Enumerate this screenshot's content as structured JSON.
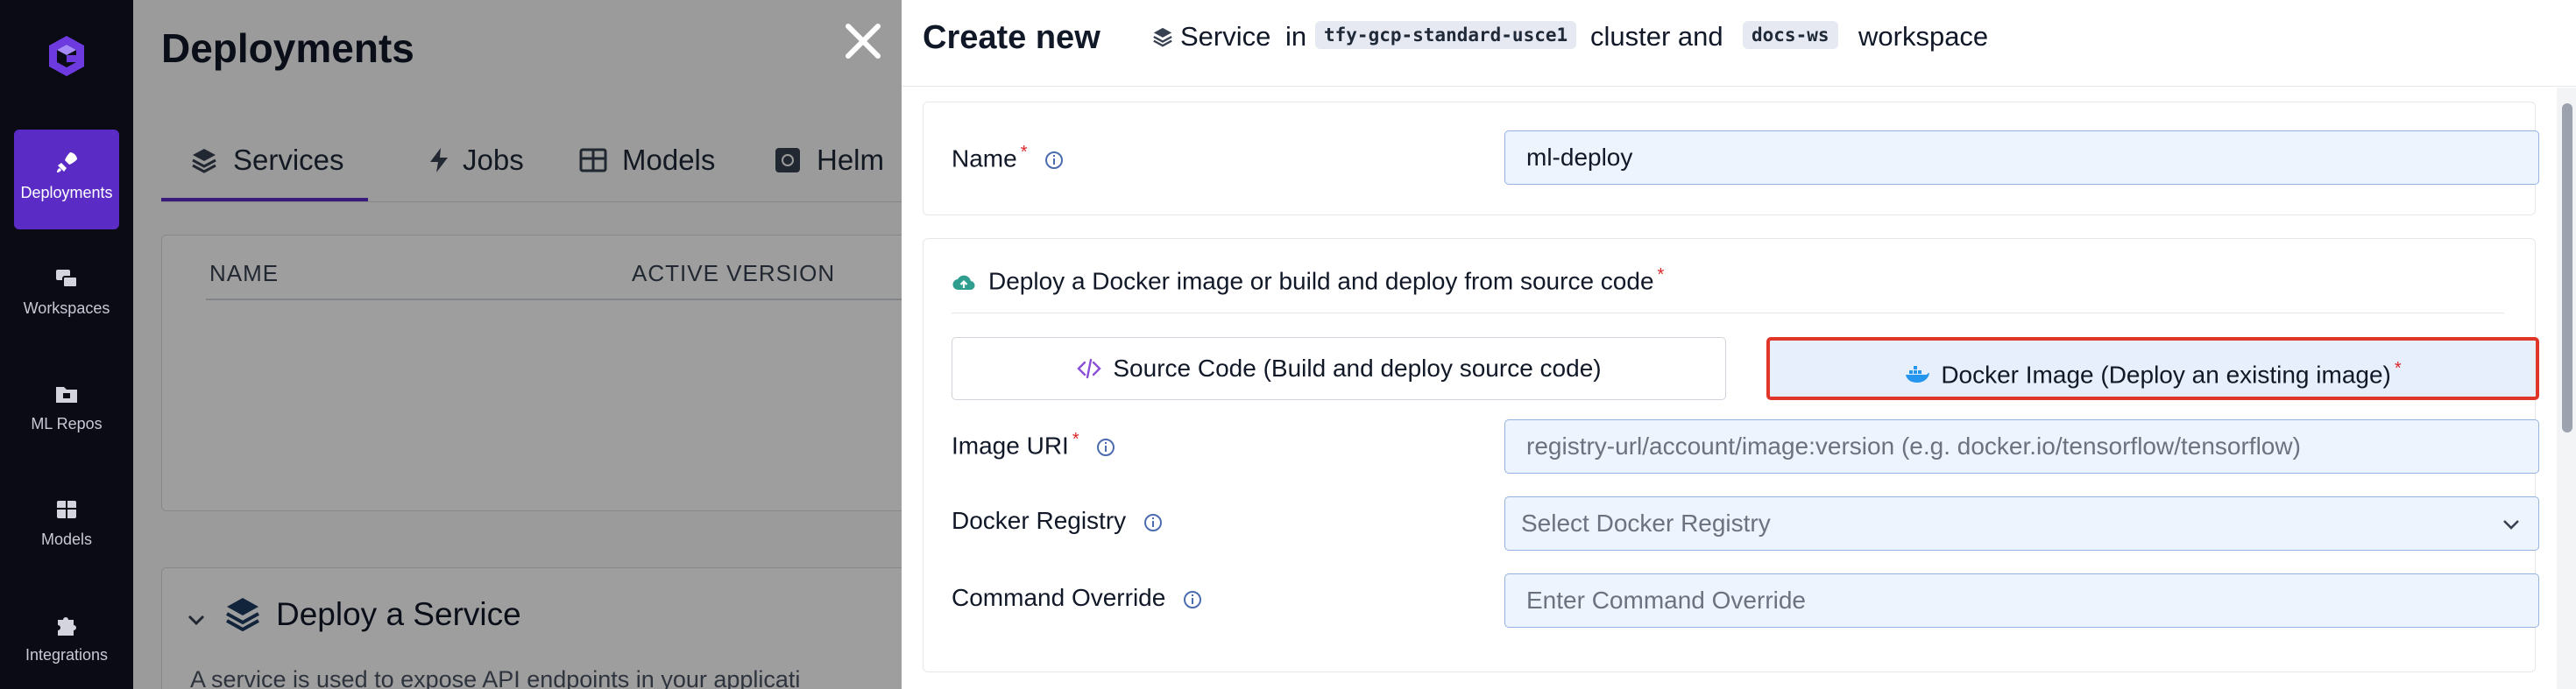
{
  "nav": {
    "items": [
      {
        "label": "Deployments",
        "icon": "rocket-icon",
        "active": true
      },
      {
        "label": "Workspaces",
        "icon": "workspaces-icon",
        "active": false
      },
      {
        "label": "ML Repos",
        "icon": "folder-icon",
        "active": false
      },
      {
        "label": "Models",
        "icon": "grid-icon",
        "active": false
      },
      {
        "label": "Integrations",
        "icon": "puzzle-icon",
        "active": false
      }
    ]
  },
  "background": {
    "title": "Deployments",
    "tabs": [
      {
        "label": "Services",
        "icon": "layers-icon"
      },
      {
        "label": "Jobs",
        "icon": "bolt-icon"
      },
      {
        "label": "Models",
        "icon": "table-icon"
      },
      {
        "label": "Helm",
        "icon": "helm-icon"
      }
    ],
    "table_headers": [
      "NAME",
      "ACTIVE VERSION"
    ],
    "card": {
      "title": "Deploy a Service",
      "desc": "A service is used to expose API endpoints in your applicati"
    }
  },
  "drawer": {
    "title": "Create new",
    "type_label": "Service",
    "in_text": "in",
    "cluster_chip": "tfy-gcp-standard-usce1",
    "cluster_text": "cluster and",
    "workspace_chip": "docs-ws",
    "workspace_text": "workspace"
  },
  "form": {
    "name_label": "Name",
    "name_value": "ml-deploy",
    "source_heading": "Deploy a Docker image or build and deploy from source code",
    "options": [
      {
        "label": "Source Code (Build and deploy source code)",
        "icon": "code-icon",
        "selected": false
      },
      {
        "label": "Docker Image (Deploy an existing image)",
        "icon": "docker-icon",
        "selected": true
      }
    ],
    "image_uri_label": "Image URI",
    "image_uri_placeholder": "registry-url/account/image:version (e.g. docker.io/tensorflow/tensorflow)",
    "docker_registry_label": "Docker Registry",
    "docker_registry_placeholder": "Select Docker Registry",
    "command_override_label": "Command Override",
    "command_override_placeholder": "Enter Command Override"
  },
  "colors": {
    "accent": "#5b2cc5",
    "selected_border": "#e0362a",
    "required": "#dc2626",
    "field_bg": "#eef4fd",
    "rail_bg": "#0b0b16"
  }
}
